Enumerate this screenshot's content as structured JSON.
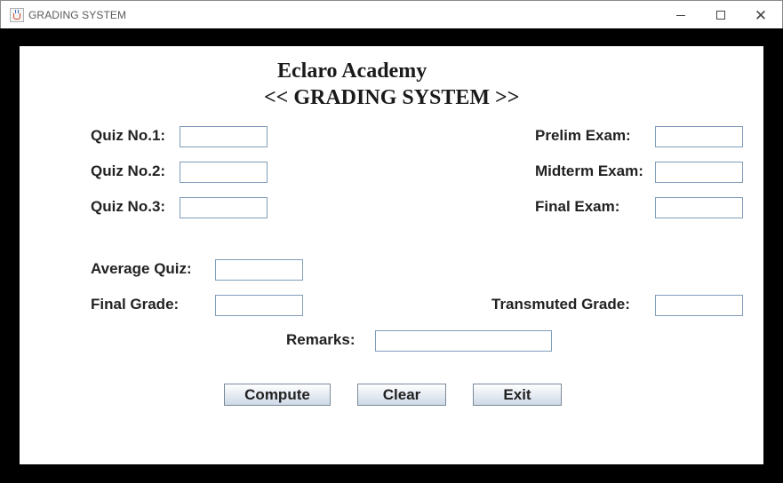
{
  "window": {
    "title": "GRADING SYSTEM"
  },
  "header": {
    "school": "Eclaro Academy",
    "system": "<< GRADING SYSTEM >>"
  },
  "quizzes": {
    "quiz1_label": "Quiz No.1:",
    "quiz2_label": "Quiz No.2:",
    "quiz3_label": "Quiz No.3:",
    "quiz1_value": "",
    "quiz2_value": "",
    "quiz3_value": ""
  },
  "exams": {
    "prelim_label": "Prelim Exam:",
    "midterm_label": "Midterm Exam:",
    "final_label": "Final Exam:",
    "prelim_value": "",
    "midterm_value": "",
    "final_value": ""
  },
  "results": {
    "average_label": "Average Quiz:",
    "final_grade_label": "Final Grade:",
    "transmuted_label": "Transmuted Grade:",
    "remarks_label": "Remarks:",
    "average_value": "",
    "final_grade_value": "",
    "transmuted_value": "",
    "remarks_value": ""
  },
  "buttons": {
    "compute": "Compute",
    "clear": "Clear",
    "exit": "Exit"
  }
}
